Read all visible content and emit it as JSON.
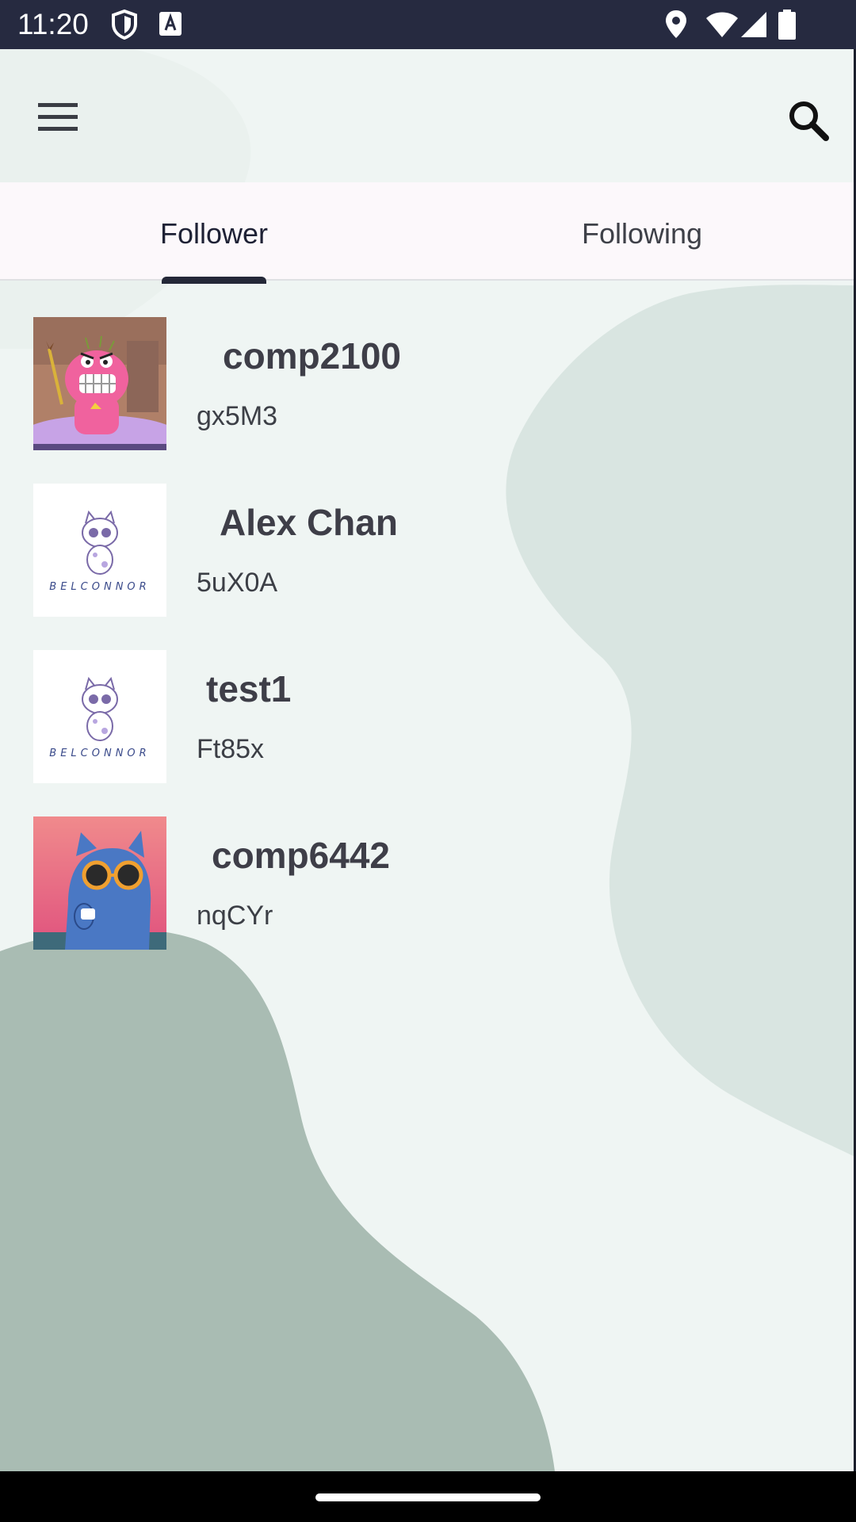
{
  "status_bar": {
    "time": "11:20",
    "icons": [
      "shield-icon",
      "keyboard-a-icon",
      "location-pin-icon",
      "wifi-icon",
      "cell-signal-icon",
      "battery-icon"
    ]
  },
  "app_bar": {
    "menu_icon": "hamburger-menu-icon",
    "search_icon": "search-icon"
  },
  "tabs": [
    {
      "label": "Follower",
      "active": true
    },
    {
      "label": "Following",
      "active": false
    }
  ],
  "users": [
    {
      "name": "comp2100",
      "id": "gx5M3",
      "avatar": "pink-monster-avatar"
    },
    {
      "name": "Alex Chan",
      "id": "5uX0A",
      "avatar": "belconnor-cat-avatar"
    },
    {
      "name": "test1",
      "id": "Ft85x",
      "avatar": "belconnor-cat-avatar"
    },
    {
      "name": "comp6442",
      "id": "nqCYr",
      "avatar": "blue-cat-sunglasses-avatar"
    }
  ],
  "avatar_caption": "BELCONNOR",
  "colors": {
    "status_bar": "#262a40",
    "background": "#eff5f3",
    "blob_light": "#d9e5e1",
    "blob_dark": "#a9bcb3",
    "tab_bg": "#fcf8fb",
    "indicator": "#242838"
  }
}
